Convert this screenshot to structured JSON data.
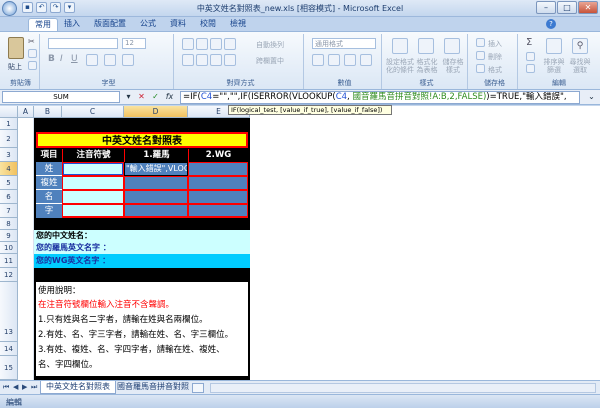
{
  "window": {
    "title": "中英文姓名對照表_new.xls [相容模式] - Microsoft Excel"
  },
  "tabs": [
    "常用",
    "插入",
    "版面配置",
    "公式",
    "資料",
    "校閱",
    "檢視"
  ],
  "ribbon": {
    "groups": [
      "剪貼簿",
      "字型",
      "對齊方式",
      "數值",
      "樣式",
      "儲存格",
      "編輯"
    ],
    "paste": "貼上",
    "font_size": "12",
    "wrap_text": "自動換列",
    "merge_center": "跨欄置中",
    "number_format": "通用格式",
    "cond_format": "設定格式化的條件",
    "table_format": "格式化為表格",
    "cell_styles": "儲存格樣式",
    "insert": "插入",
    "delete": "刪除",
    "format": "格式",
    "sort_filter": "排序與篩選",
    "find_select": "尋找與選取"
  },
  "formula_bar": {
    "name_box": "SUM",
    "fx_label": "fx",
    "formula_parts": [
      "=IF(",
      "C4",
      "=\"\",\"\",IF(ISERROR(VLOOKUP(",
      "C4",
      ", ",
      "國音羅馬音拼音對照!A:B,2,FALSE)",
      ")=TRUE,\"輸入錯誤\","
    ],
    "tooltip": "IF(logical_test, [value_if_true], [value_if_false])"
  },
  "columns": [
    "A",
    "B",
    "C",
    "D",
    "E"
  ],
  "rows": [
    "1",
    "2",
    "3",
    "4",
    "5",
    "6",
    "7",
    "8",
    "9",
    "10",
    "11",
    "12",
    "13",
    "14",
    "15"
  ],
  "sheet": {
    "table_title": "中英文姓名對照表",
    "headers": [
      "項目",
      "注音符號",
      "1.羅馬",
      "2.WG"
    ],
    "items": [
      "姓",
      "複姓",
      "名",
      "字"
    ],
    "edit_cell": "\"輸入錯誤\",VLOOKUP(",
    "name_cn": "您的中文姓名：",
    "name_roman": "您的羅馬英文名字 ：",
    "name_wg": "您的WG英文名字 ：",
    "notes_title": "使用說明：",
    "notes_red": "在注音符號欄位輸入注音不含聲調。",
    "notes": [
      "1.只有姓與名二字者，請輸在姓與名兩欄位。",
      "2.有姓、名、字三字者，請輸在姓、名、字三欄位。",
      "3.有姓、複姓、名、字四字者，請輸在姓、複姓、",
      "名、字四欄位。"
    ]
  },
  "sheet_tabs": [
    "中英文姓名對照表",
    "國音羅馬音拼音對照"
  ],
  "status": "編輯",
  "colors": {
    "title_bg": "#ffff00",
    "header_bg": "#000000",
    "cell_blue": "#4f81bd",
    "cell_light": "#ccffff",
    "border_red": "#ff0000",
    "row_light": "#ccffff",
    "row_blue": "#00ccff"
  }
}
